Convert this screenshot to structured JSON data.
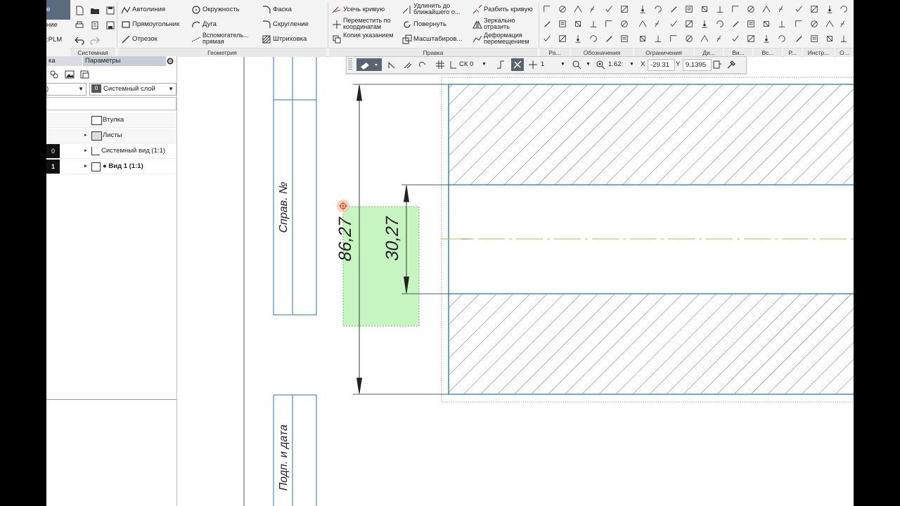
{
  "ribbon": {
    "tab_partial": "е",
    "left_labels": [
      "ние",
      ":PLM"
    ],
    "system": {
      "section": "Системная"
    },
    "geometry": {
      "section": "Геометрия",
      "autoline": "Автолиния",
      "rectangle": "Прямоугольник",
      "segment": "Отрезок",
      "circle": "Окружность",
      "arc": "Дуга",
      "aux_line": "Вспомогатель... прямая",
      "chamfer": "Фаска",
      "fillet": "Скругление",
      "hatch": "Штриховка"
    },
    "edit": {
      "section": "Правка",
      "trim": "Усечь кривую",
      "move": "Переместить по координатам",
      "copy": "Копия указанием",
      "extend": "Удлинить до ближайшего о...",
      "rotate": "Повернуть",
      "scale": "Масштабиров...",
      "split": "Разбить кривую",
      "mirror": "Зеркально отразить",
      "deform": "Деформация перемещением"
    },
    "sections_small": [
      "Ра...",
      "Обозначения",
      "Ограничения",
      "Ди...",
      "Ви...",
      "Вс...",
      "Р...",
      "Инстр...",
      "О..."
    ]
  },
  "panel": {
    "tab1": "ка",
    "tab2": "Параметры",
    "combo_left": ")",
    "layer_index": "0",
    "layer_name": "Системный слой",
    "tree": [
      {
        "label": "Втулка",
        "num": ""
      },
      {
        "label": "Листы",
        "num": ""
      },
      {
        "label": "Системный вид (1:1)",
        "num": "0"
      },
      {
        "label": "● Вид 1 (1:1)",
        "num": "1"
      }
    ]
  },
  "floatbar": {
    "cs": "СК 0",
    "step": "1",
    "zoom": "1.62:",
    "x_label": "X",
    "x_value": "-29.31",
    "y_label": "Y",
    "y_value": "9.1395"
  },
  "drawing": {
    "dim_outer": "86,27",
    "dim_inner": "30,27",
    "stamp_top": "Справ. №",
    "stamp_bottom": "Подп. и дата"
  },
  "colors": {
    "part_outline": "#3d8fc6",
    "centerline": "#d8c070",
    "selection_fill": "#c7f5c2",
    "ribbon_bg": "#f3f3f3"
  }
}
